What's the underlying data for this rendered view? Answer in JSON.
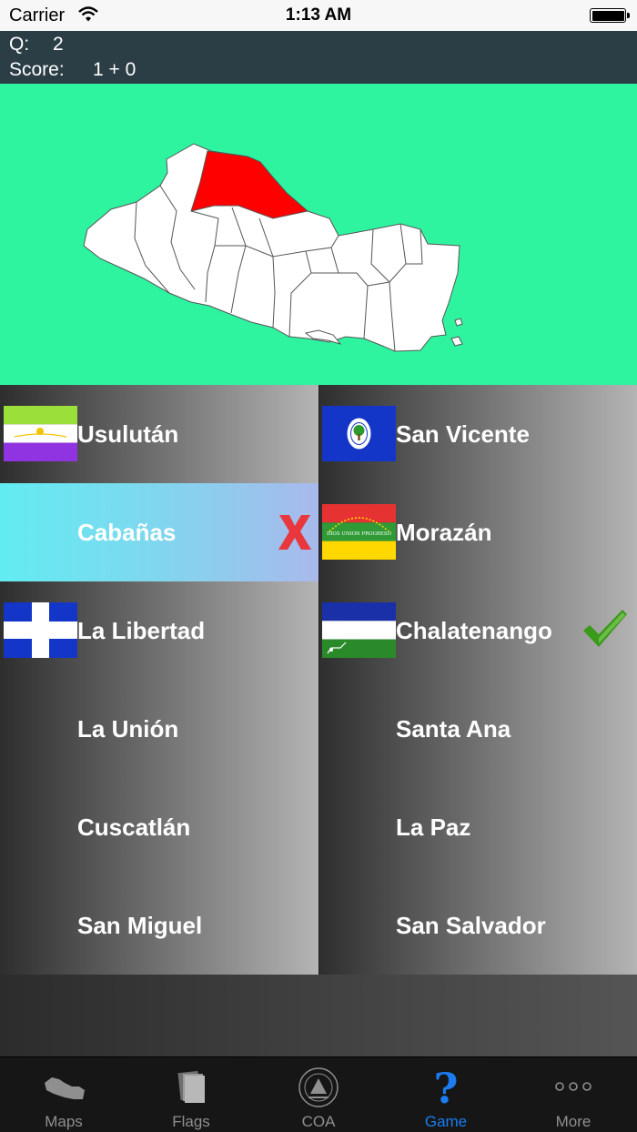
{
  "status_bar": {
    "carrier": "Carrier",
    "time": "1:13 AM"
  },
  "score": {
    "q_label": "Q:",
    "q_value": "2",
    "score_label": "Score:",
    "score_value": "1 + 0"
  },
  "map": {
    "background": "#2ef4a0",
    "highlight_color": "#ff0000",
    "region_fill": "#ffffff"
  },
  "answers": [
    {
      "label": "Usulután",
      "flag": "usulutan-flag",
      "state": "normal"
    },
    {
      "label": "San Vicente",
      "flag": "san-vicente-flag",
      "state": "normal"
    },
    {
      "label": "Cabañas",
      "flag": "",
      "state": "wrong"
    },
    {
      "label": "Morazán",
      "flag": "morazan-flag",
      "flag_text": "DIOS UNION PROGRESO",
      "state": "normal"
    },
    {
      "label": "La Libertad",
      "flag": "la-libertad-flag",
      "state": "normal"
    },
    {
      "label": "Chalatenango",
      "flag": "chalatenango-flag",
      "state": "correct"
    },
    {
      "label": "La Unión",
      "flag": "",
      "state": "normal"
    },
    {
      "label": "Santa Ana",
      "flag": "",
      "state": "normal"
    },
    {
      "label": "Cuscatlán",
      "flag": "",
      "state": "normal"
    },
    {
      "label": "La Paz",
      "flag": "",
      "state": "normal"
    },
    {
      "label": "San Miguel",
      "flag": "",
      "state": "normal"
    },
    {
      "label": "San Salvador",
      "flag": "",
      "state": "normal"
    }
  ],
  "tabs": [
    {
      "label": "Maps",
      "icon": "map-icon",
      "active": false
    },
    {
      "label": "Flags",
      "icon": "flags-icon",
      "active": false
    },
    {
      "label": "COA",
      "icon": "coat-of-arms-icon",
      "active": false
    },
    {
      "label": "Game",
      "icon": "question-mark-icon",
      "active": true
    },
    {
      "label": "More",
      "icon": "more-dots-icon",
      "active": false
    }
  ],
  "colors": {
    "accent": "#1a7cf0",
    "header": "#2c3e45",
    "wrong_mark": "#e8383d",
    "correct_mark": "#3a9a1a"
  }
}
